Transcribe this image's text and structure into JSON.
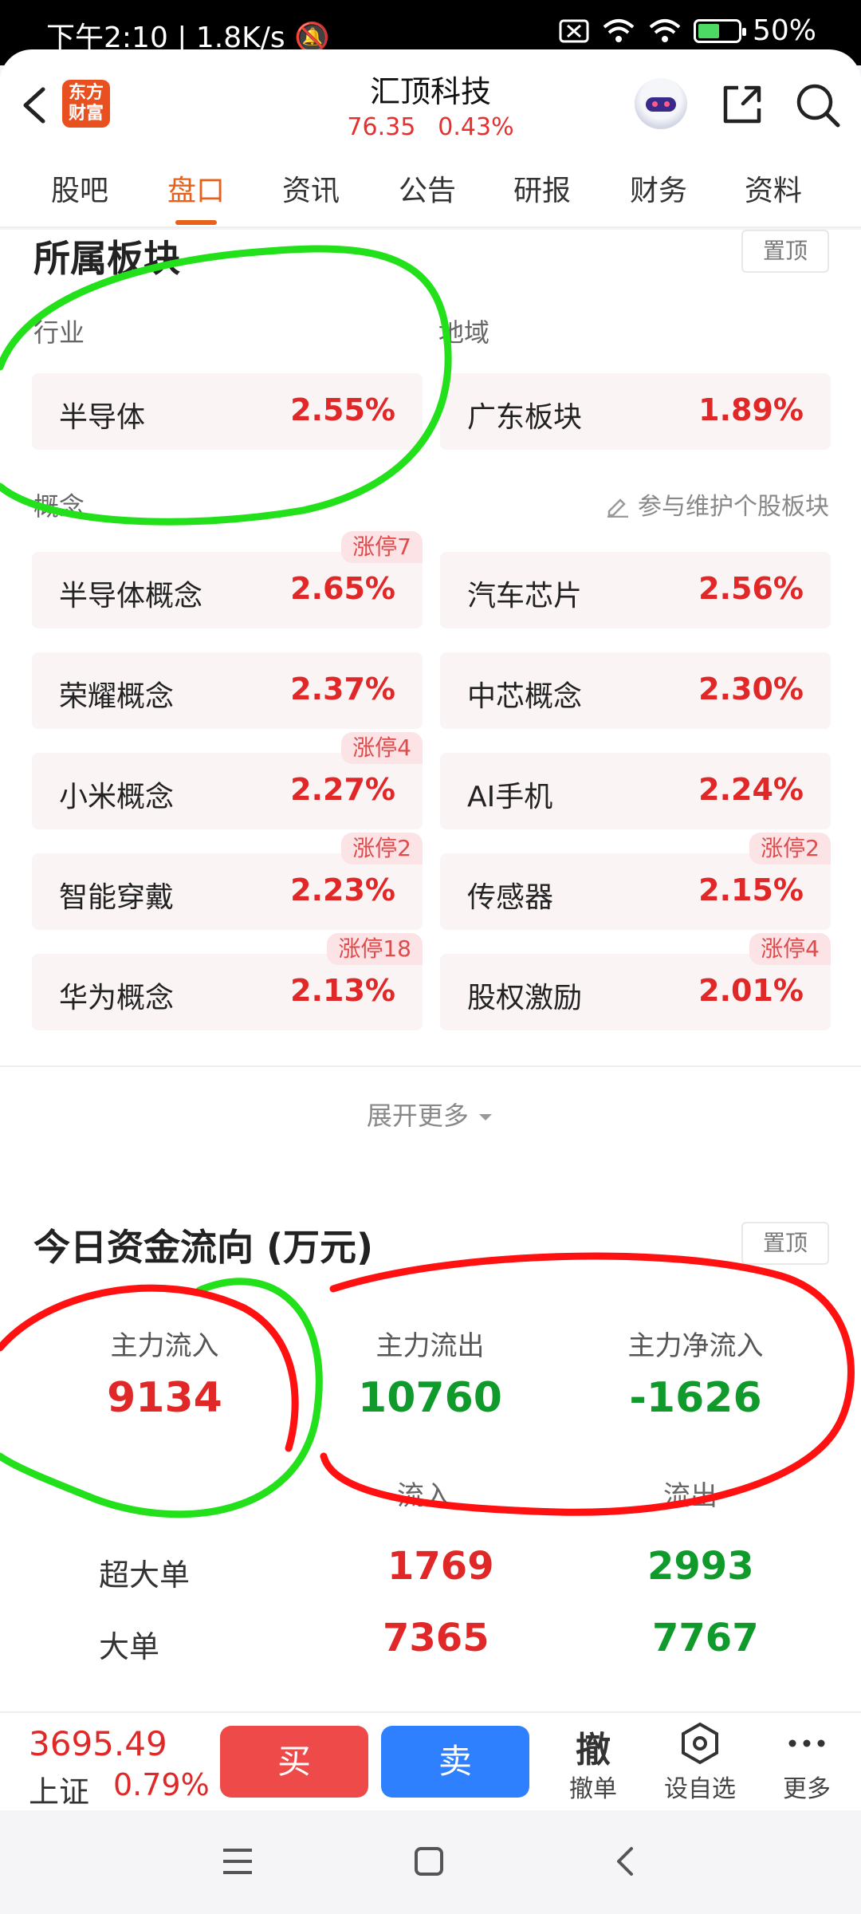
{
  "status_bar": {
    "time": "下午2:10",
    "speed": "1.8K/s",
    "battery": "50%"
  },
  "header": {
    "logo_text": "东方财富",
    "stock_name": "汇顶科技",
    "price": "76.35",
    "change": "0.43%"
  },
  "tabs": [
    "股吧",
    "盘口",
    "资讯",
    "公告",
    "研报",
    "财务",
    "资料"
  ],
  "active_tab": "盘口",
  "sector": {
    "title": "所属板块",
    "pin_label": "置顶",
    "industry_label": "行业",
    "region_label": "地域",
    "industry": {
      "name": "半导体",
      "pct": "2.55%"
    },
    "region": {
      "name": "广东板块",
      "pct": "1.89%"
    },
    "concept_label": "概念",
    "maintain_label": "参与维护个股板块",
    "concepts": [
      {
        "name": "半导体概念",
        "pct": "2.65%",
        "badge": "涨停7"
      },
      {
        "name": "汽车芯片",
        "pct": "2.56%",
        "badge": ""
      },
      {
        "name": "荣耀概念",
        "pct": "2.37%",
        "badge": ""
      },
      {
        "name": "中芯概念",
        "pct": "2.30%",
        "badge": ""
      },
      {
        "name": "小米概念",
        "pct": "2.27%",
        "badge": "涨停4"
      },
      {
        "name": "AI手机",
        "pct": "2.24%",
        "badge": ""
      },
      {
        "name": "智能穿戴",
        "pct": "2.23%",
        "badge": "涨停2"
      },
      {
        "name": "传感器",
        "pct": "2.15%",
        "badge": "涨停2"
      },
      {
        "name": "华为概念",
        "pct": "2.13%",
        "badge": "涨停18"
      },
      {
        "name": "股权激励",
        "pct": "2.01%",
        "badge": "涨停4"
      }
    ],
    "expand_label": "展开更多"
  },
  "fund_flow": {
    "title": "今日资金流向 (万元)",
    "pin_label": "置顶",
    "main_in_label": "主力流入",
    "main_in": "9134",
    "main_out_label": "主力流出",
    "main_out": "10760",
    "main_net_label": "主力净流入",
    "main_net": "-1626",
    "col_in": "流入",
    "col_out": "流出",
    "rows": [
      {
        "label": "超大单",
        "in": "1769",
        "out": "2993"
      },
      {
        "label": "大单",
        "in": "7365",
        "out": "7767"
      }
    ]
  },
  "bottom_bar": {
    "index_value": "3695.49",
    "index_name": "上证",
    "index_pct": "0.79%",
    "buy": "买",
    "sell": "卖",
    "cancel_icon": "撤",
    "cancel_label": "撤单",
    "watch_label": "设自选",
    "more_label": "更多"
  },
  "colors": {
    "up": "#e02828",
    "down": "#109a2c",
    "accent": "#e8611a",
    "annotation_green": "#22e01a",
    "annotation_red": "#ff1111"
  }
}
